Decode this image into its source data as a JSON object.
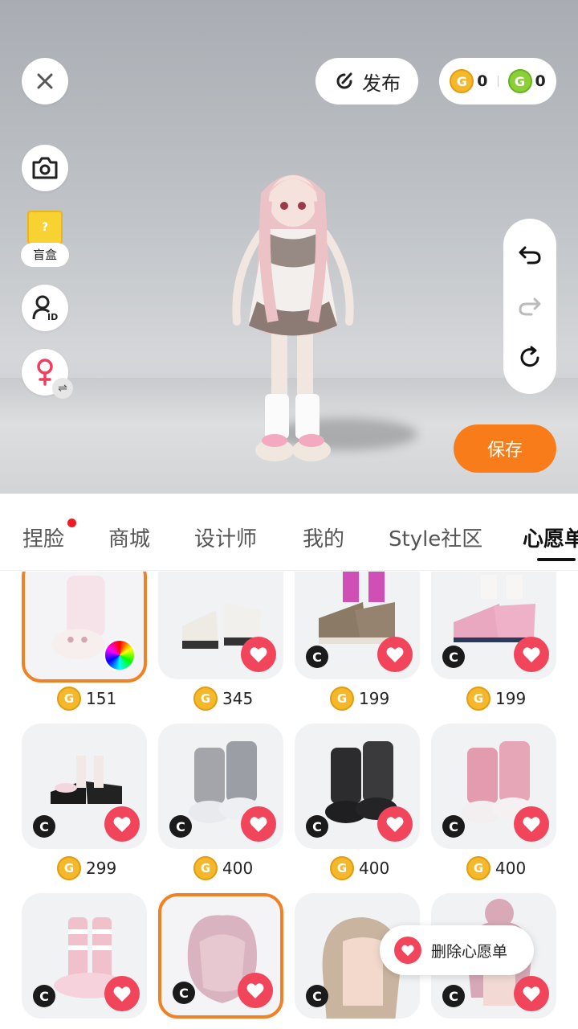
{
  "header": {
    "publish_label": "发布",
    "coins": [
      {
        "type": "gold",
        "symbol": "G",
        "value": "0"
      },
      {
        "type": "green",
        "symbol": "G",
        "value": "0"
      }
    ]
  },
  "left_tools": {
    "blindbox_label": "盲盒",
    "blindbox_mark": "?"
  },
  "save_label": "保存",
  "tabs": [
    {
      "label": "捏脸",
      "has_dot": true
    },
    {
      "label": "商城"
    },
    {
      "label": "设计师"
    },
    {
      "label": "我的"
    },
    {
      "label": "Style社区"
    },
    {
      "label": "心愿单",
      "active": true
    }
  ],
  "items": [
    {
      "price": "151",
      "kind": "socks-shoes",
      "creator_badge": false,
      "colorwheel": true,
      "selected": true
    },
    {
      "price": "345",
      "kind": "platform-sneakers",
      "creator_badge": false
    },
    {
      "price": "199",
      "kind": "brown-sneakers",
      "creator_badge": true
    },
    {
      "price": "199",
      "kind": "pink-sneakers",
      "creator_badge": true
    },
    {
      "price": "299",
      "kind": "black-mary-janes",
      "creator_badge": true
    },
    {
      "price": "400",
      "kind": "grey-leg-warmers",
      "creator_badge": true
    },
    {
      "price": "400",
      "kind": "black-leg-warmers",
      "creator_badge": true
    },
    {
      "price": "400",
      "kind": "pink-leg-warmers",
      "creator_badge": true
    },
    {
      "price": "",
      "kind": "pink-striped-socks",
      "creator_badge": true
    },
    {
      "price": "",
      "kind": "pink-hair",
      "creator_badge": true,
      "selected": true
    },
    {
      "price": "",
      "kind": "blonde-hair",
      "creator_badge": true
    },
    {
      "price": "",
      "kind": "bun-hair",
      "creator_badge": true
    }
  ],
  "badge_symbol": "C",
  "toast_label": "删除心愿单"
}
